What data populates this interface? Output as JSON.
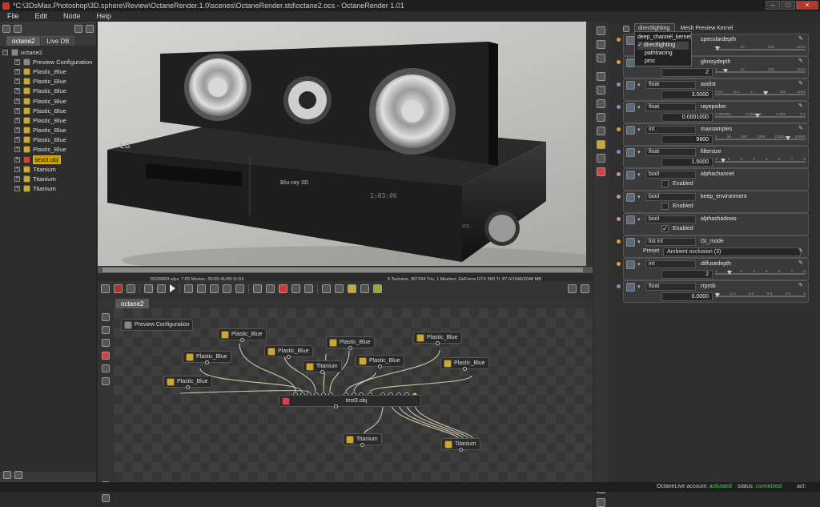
{
  "window": {
    "title": "*C:\\3DsMax.Photoshop\\3D.sphere\\Review\\OctaneRender.1.0\\scenes\\OctaneRender.std\\octane2.ocs - OctaneRender 1.01",
    "buttons": [
      "–",
      "□",
      "✕"
    ]
  },
  "menu": [
    "File",
    "Edit",
    "Node",
    "Help"
  ],
  "outliner": {
    "tabs": [
      "octane2",
      "Live DB"
    ],
    "root": "octane2",
    "items": [
      "Preview Configuration",
      "Plastic_Blue",
      "Plastic_Blue",
      "Plastic_Blue",
      "Plastic_Blue",
      "Plastic_Blue",
      "Plastic_Blue",
      "Plastic_Blue",
      "Plastic_Blue",
      "Plastic_Blue",
      "test3.obj",
      "Titanium",
      "Titanium",
      "Titanium"
    ],
    "selected_index": 10
  },
  "render_status": {
    "left": "552/9600 s/px, 7.83 Ms/sec, 00:00:41/00:11:53",
    "right": "5 Textures, 367334 Tris, 1 Meshes, GeForce GTX 560 Ti, 87.0/1646/2048 MB"
  },
  "scene_text": {
    "brand": "LG",
    "disc_logo": "Blu-ray 3D",
    "display": "1:03:06",
    "vol": "VOL"
  },
  "nodegraph": {
    "tab": "octane2",
    "nodes": {
      "preview": "Preview Configuration",
      "pb1": "Plastic_Blue",
      "pb2": "Plastic_Blue",
      "pb3": "Plastic_Blue",
      "pb4": "Plastic_Blue",
      "pb5": "Plastic_Blue",
      "pb6": "Plastic_Blue",
      "pb7": "Plastic_Blue",
      "pb8": "Plastic_Blue",
      "ti1": "Titanium",
      "ti2": "Titanium",
      "ti3": "Titanium",
      "obj": "test3.obj"
    }
  },
  "kernel": {
    "selected": "directlighting",
    "label": "Mesh Preview Kernel",
    "options": [
      "deep_channel_kernel",
      "directlighting",
      "pathtracing",
      "pmc"
    ],
    "checked": "directlighting"
  },
  "params": [
    {
      "name": "speculardepth",
      "type": "",
      "value": "",
      "ticks": [
        "1",
        "10",
        "100",
        "1024"
      ]
    },
    {
      "name": "glossydepth",
      "type": "",
      "value": "2",
      "ticks": [
        "1",
        "10",
        "100",
        "1024"
      ]
    },
    {
      "name": "aodist",
      "type": "float",
      "value": "3.0000",
      "ticks": [
        "0.01",
        "0.1",
        "1",
        "10",
        "100",
        "1024"
      ]
    },
    {
      "name": "rayepsilon",
      "type": "float",
      "value": "0.0001000",
      "ticks": [
        "0.000001",
        "0.000001",
        "0.001",
        "0.1"
      ]
    },
    {
      "name": "maxsamples",
      "type": "int",
      "value": "9600",
      "ticks": [
        "1",
        "10",
        "100",
        "1000",
        "10000",
        "64000"
      ]
    },
    {
      "name": "filtersize",
      "type": "float",
      "value": "1.5000",
      "ticks": [
        "1",
        "2",
        "3",
        "4",
        "5",
        "6",
        "7",
        "8"
      ]
    },
    {
      "name": "alphachannel",
      "type": "bool",
      "check_label": "Enabled",
      "checked": false
    },
    {
      "name": "keep_environment",
      "type": "bool",
      "check_label": "Enabled",
      "checked": false
    },
    {
      "name": "alphashadows",
      "type": "bool",
      "check_label": "Enabled",
      "checked": true
    },
    {
      "name": "GI_mode",
      "type": "list int",
      "preset_label": "Preset",
      "preset_value": "Ambient occlusion (3)"
    },
    {
      "name": "diffusedepth",
      "type": "int",
      "value": "2",
      "ticks": [
        "1",
        "2",
        "3",
        "4",
        "5",
        "6",
        "7",
        "8"
      ]
    },
    {
      "name": "rrprob",
      "type": "float",
      "value": "0.0000",
      "ticks": [
        "0",
        "0.2",
        "0.4",
        "0.6",
        "0.8",
        "1"
      ]
    }
  ],
  "footer": {
    "account_label": "OctaneLive account:",
    "account_value": "activated",
    "status_label": "status:",
    "status_value": "connected",
    "act_label": "act:"
  },
  "colors": {
    "accent_yellow": "#c9a000",
    "status_green": "#49d14d",
    "close_red": "#b03a2e"
  }
}
